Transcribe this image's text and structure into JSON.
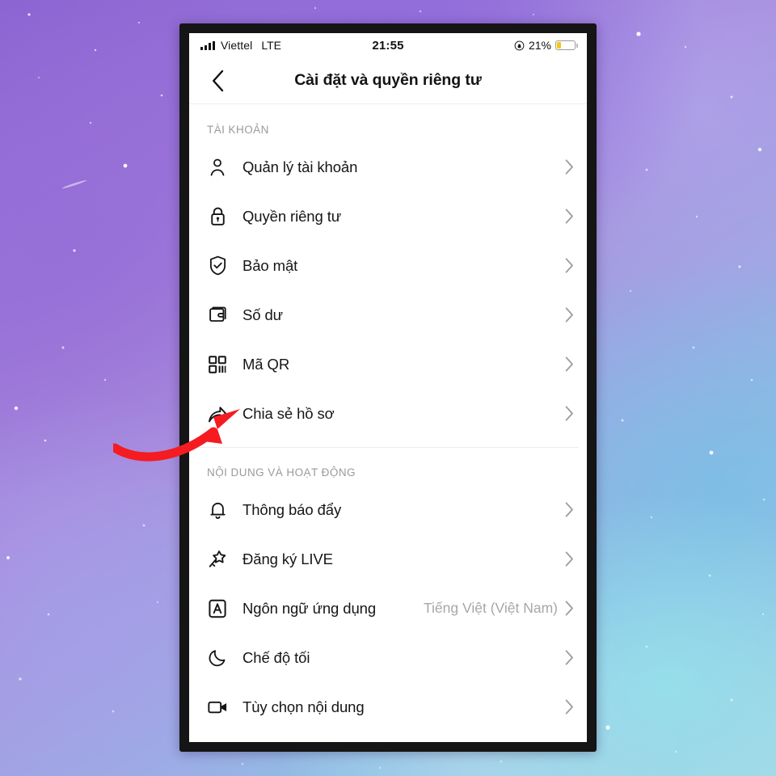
{
  "wallpaper": {
    "name": "purple-nebula-starfield"
  },
  "status_bar": {
    "carrier": "Viettel",
    "network": "LTE",
    "time": "21:55",
    "battery_percent": "21%",
    "battery_level": 21,
    "battery_color": "#f5c518",
    "rotation_lock_icon": "rotation-lock-icon",
    "signal_icon": "signal-bars-icon"
  },
  "nav": {
    "back_icon": "chevron-left-icon",
    "title": "Cài đặt và quyền riêng tư"
  },
  "sections": [
    {
      "header": "TÀI KHOẢN",
      "rows": [
        {
          "icon": "person-icon",
          "label": "Quản lý tài khoản",
          "value": "",
          "chevron": "chevron-right-icon"
        },
        {
          "icon": "lock-icon",
          "label": "Quyền riêng tư",
          "value": "",
          "chevron": "chevron-right-icon"
        },
        {
          "icon": "shield-check-icon",
          "label": "Bảo mật",
          "value": "",
          "chevron": "chevron-right-icon"
        },
        {
          "icon": "wallet-icon",
          "label": "Số dư",
          "value": "",
          "chevron": "chevron-right-icon"
        },
        {
          "icon": "qr-code-icon",
          "label": "Mã QR",
          "value": "",
          "chevron": "chevron-right-icon"
        },
        {
          "icon": "share-arrow-icon",
          "label": "Chia sẻ hồ sơ",
          "value": "",
          "chevron": "chevron-right-icon"
        }
      ]
    },
    {
      "header": "NỘI DUNG VÀ HOẠT ĐỘNG",
      "rows": [
        {
          "icon": "bell-icon",
          "label": "Thông báo đẩy",
          "value": "",
          "chevron": "chevron-right-icon"
        },
        {
          "icon": "comet-live-icon",
          "label": "Đăng ký LIVE",
          "value": "",
          "chevron": "chevron-right-icon"
        },
        {
          "icon": "language-a-icon",
          "label": "Ngôn ngữ ứng dụng",
          "value": "Tiếng Việt (Việt Nam)",
          "chevron": "chevron-right-icon"
        },
        {
          "icon": "moon-icon",
          "label": "Chế độ tối",
          "value": "",
          "chevron": "chevron-right-icon"
        },
        {
          "icon": "video-camera-icon",
          "label": "Tùy chọn nội dung",
          "value": "",
          "chevron": "chevron-right-icon"
        }
      ]
    }
  ],
  "annotation": {
    "type": "curved-arrow",
    "color": "#f41c20",
    "points_to": "Chia sẻ hồ sơ"
  }
}
